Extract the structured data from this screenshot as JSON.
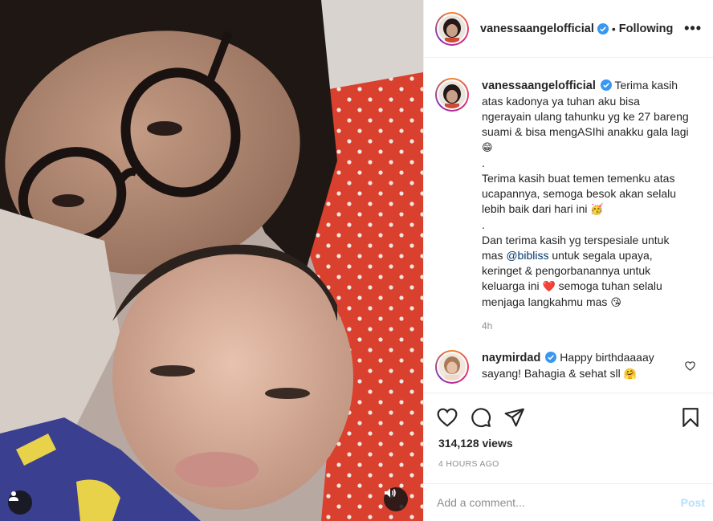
{
  "media": {
    "type": "video",
    "user_tag_icon": "user-icon",
    "mute_icon": "speaker-icon"
  },
  "header": {
    "username": "vanessaangelofficial",
    "verified_icon": "verified-badge-icon",
    "separator": "•",
    "follow_status": "Following",
    "more": "•••"
  },
  "caption": {
    "username": "vanessaangelofficial",
    "paragraph1": "Terima kasih atas kadonya ya tuhan aku bisa ngerayain ulang tahunku yg ke 27 bareng suami & bisa mengASIhi anakku gala lagi",
    "emoji1": "😁",
    "dot1": ".",
    "paragraph2": "Terima kasih buat temen temenku atas ucapannya, semoga besok akan selalu lebih baik dari hari ini",
    "emoji2": "🥳",
    "dot2": ".",
    "paragraph3_pre": "Dan terima kasih yg terspesiale untuk mas",
    "mention": "@bibliss",
    "paragraph3_mid": "untuk segala upaya, keringet & pengorbanannya untuk keluarga ini",
    "emoji3": "❤️",
    "paragraph3_post": "semoga tuhan selalu menjaga langkahmu mas",
    "emoji4": "😘",
    "age": "4h"
  },
  "reply": {
    "username": "naymirdad",
    "text": "Happy birthdaaaay sayang! Bahagia & sehat sll",
    "emoji": "🤗",
    "like_icon": "heart-outline-icon"
  },
  "actions": {
    "like_icon": "heart-outline-icon",
    "comment_icon": "comment-bubble-icon",
    "share_icon": "paper-plane-icon",
    "save_icon": "bookmark-icon",
    "views": "314,128 views",
    "timestamp": "4 HOURS AGO"
  },
  "comment_box": {
    "placeholder": "Add a comment...",
    "post_label": "Post"
  },
  "colors": {
    "link": "#00376b",
    "verified": "#3897f0",
    "post_disabled": "#b2dffc",
    "muted_text": "#8e8e8e",
    "divider": "#efefef"
  }
}
